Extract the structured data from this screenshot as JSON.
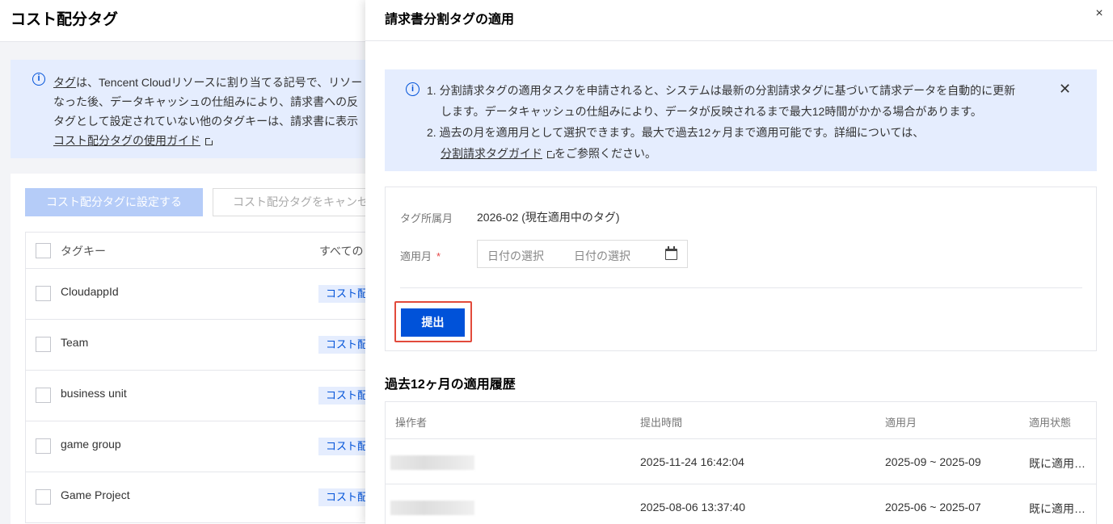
{
  "background": {
    "title": "コスト配分タグ",
    "info": {
      "line1_link": "タグ",
      "line1_rest": "は、Tencent Cloudリソースに割り当てる記号で、リソー",
      "line2": "なった後、データキャッシュの仕組みにより、請求書への反",
      "line3": "タグとして設定されていない他のタグキーは、請求書に表示",
      "guide_link": "コスト配分タグの使用ガイド"
    },
    "buttons": {
      "set": "コスト配分タグに設定する",
      "cancel": "コスト配分タグをキャンセ"
    },
    "table": {
      "col1": "タグキー",
      "col2": "すべての",
      "rows": [
        {
          "key": "CloudappId",
          "tag": "コスト配"
        },
        {
          "key": "Team",
          "tag": "コスト配"
        },
        {
          "key": "business unit",
          "tag": "コスト配"
        },
        {
          "key": "game group",
          "tag": "コスト配"
        },
        {
          "key": "Game Project",
          "tag": "コスト配"
        }
      ]
    }
  },
  "drawer": {
    "title": "請求書分割タグの適用",
    "close_icon": "×",
    "notice": {
      "item1_a": "1. 分割請求タグの適用タスクを申請されると、システムは最新の分割請求タグに基づいて請求データを自動的に更新",
      "item1_b": "します。データキャッシュの仕組みにより、データが反映されるまで最大12時間がかかる場合があります。",
      "item2_a": "2. 過去の月を適用月として選択できます。最大で過去12ヶ月まで適用可能です。詳細については、",
      "item2_link": "分割請求タグガイド",
      "item2_b": "をご参照ください。",
      "close": "✕"
    },
    "form": {
      "tag_month_label": "タグ所属月",
      "tag_month_value": "2026-02 (現在適用中のタグ)",
      "apply_month_label": "適用月",
      "required_mark": "*",
      "date_start_placeholder": "日付の選択",
      "date_end_placeholder": "日付の選択",
      "submit": "提出"
    },
    "history": {
      "title": "過去12ヶ月の適用履歴",
      "columns": [
        "操作者",
        "提出時間",
        "適用月",
        "適用状態"
      ],
      "rows": [
        {
          "operator": "",
          "submitted": "2025-11-24 16:42:04",
          "months": "2025-09 ~ 2025-09",
          "status": "既に適用済み"
        },
        {
          "operator": "",
          "submitted": "2025-08-06 13:37:40",
          "months": "2025-06 ~ 2025-07",
          "status": "既に適用済み"
        }
      ]
    }
  },
  "colors": {
    "primary": "#0052d9",
    "info_bg": "#e5edfe",
    "highlight_border": "#e24a3b",
    "required": "#e54545"
  }
}
